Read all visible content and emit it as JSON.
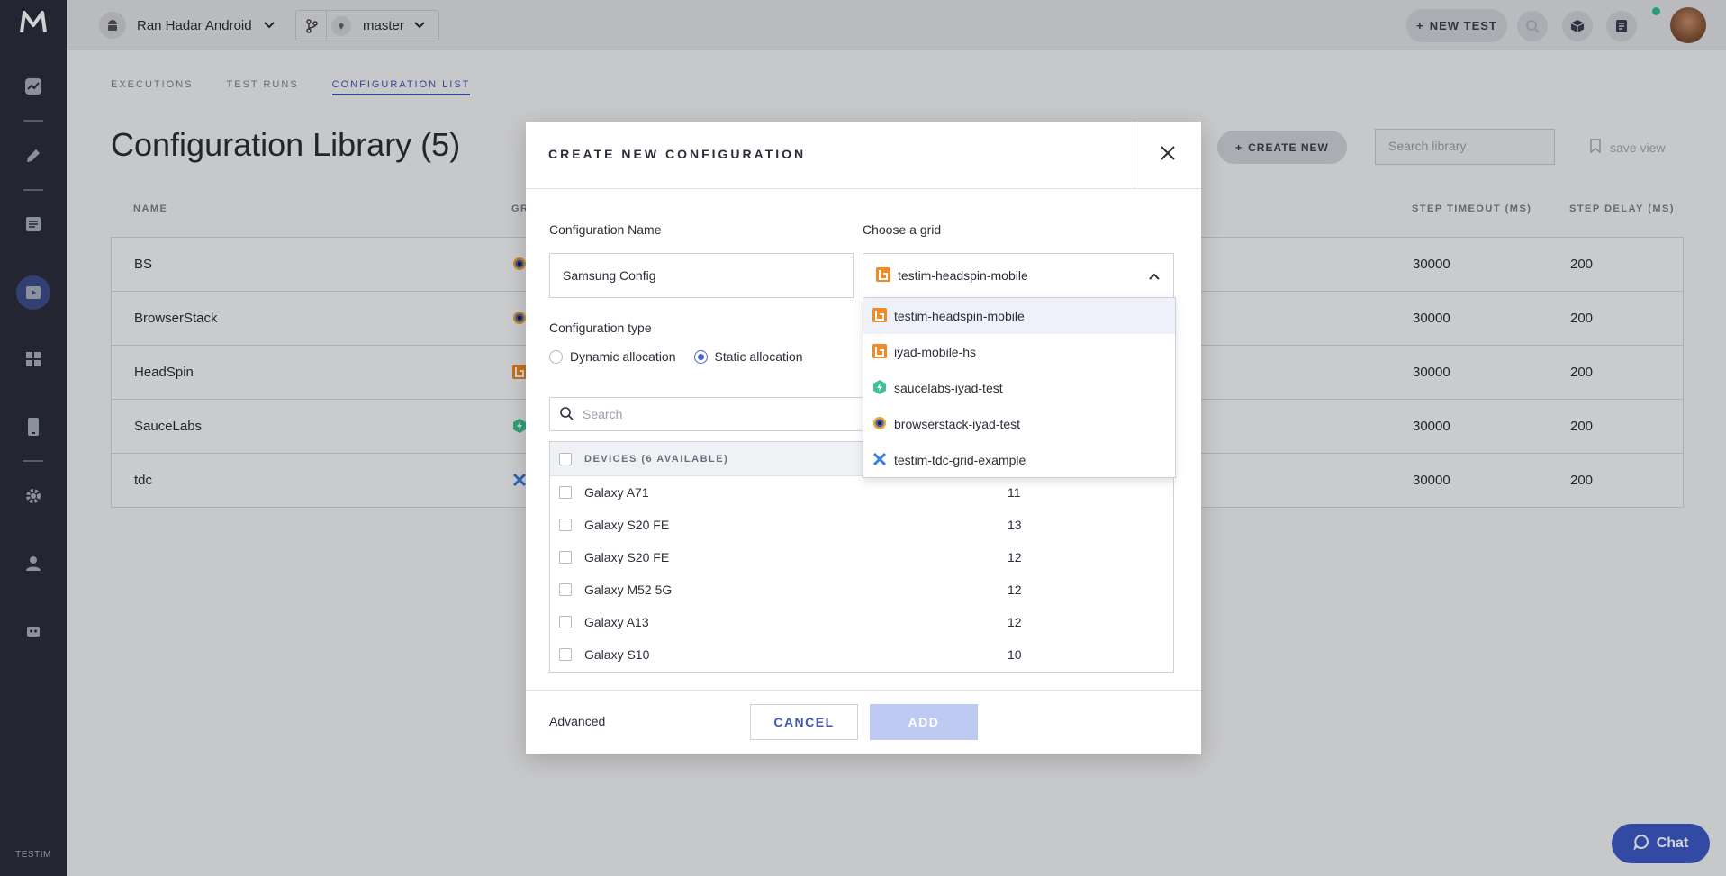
{
  "topbar": {
    "project_name": "Ran Hadar Android",
    "branch": "master",
    "new_test_label": "NEW TEST"
  },
  "sidebar": {
    "brand": "TESTIM"
  },
  "tabs": [
    "EXECUTIONS",
    "TEST RUNS",
    "CONFIGURATION LIST"
  ],
  "page": {
    "title": "Configuration Library (5)",
    "create_new_label": "CREATE NEW",
    "search_placeholder": "Search library",
    "save_view_label": "save view"
  },
  "table": {
    "columns": {
      "name": "NAME",
      "grid": "GR",
      "step_timeout": "STEP TIMEOUT (MS)",
      "step_delay": "STEP DELAY (MS)"
    },
    "rows": [
      {
        "name": "BS",
        "grid_icon": "browserstack-icon",
        "timeout": "30000",
        "delay": "200"
      },
      {
        "name": "BrowserStack",
        "grid_icon": "browserstack-icon",
        "timeout": "30000",
        "delay": "200"
      },
      {
        "name": "HeadSpin",
        "grid_icon": "headspin-icon",
        "timeout": "30000",
        "delay": "200"
      },
      {
        "name": "SauceLabs",
        "grid_icon": "saucelabs-icon",
        "timeout": "30000",
        "delay": "200"
      },
      {
        "name": "tdc",
        "grid_icon": "tdc-icon",
        "timeout": "30000",
        "delay": "200"
      }
    ]
  },
  "modal": {
    "title": "CREATE NEW CONFIGURATION",
    "config_name_label": "Configuration Name",
    "config_name_value": "Samsung Config",
    "grid_label": "Choose a grid",
    "grid_value": "testim-headspin-mobile",
    "config_type_label": "Configuration type",
    "radio_dynamic": "Dynamic allocation",
    "radio_static": "Static allocation",
    "selected_type": "static",
    "search_placeholder": "Search",
    "devices_header": "DEVICES (6 AVAILABLE)",
    "devices": [
      {
        "name": "Galaxy A71",
        "version": "11"
      },
      {
        "name": "Galaxy S20 FE",
        "version": "13"
      },
      {
        "name": "Galaxy S20 FE",
        "version": "12"
      },
      {
        "name": "Galaxy M52 5G",
        "version": "12"
      },
      {
        "name": "Galaxy A13",
        "version": "12"
      },
      {
        "name": "Galaxy S10",
        "version": "10"
      }
    ],
    "advanced_label": "Advanced",
    "cancel_label": "CANCEL",
    "add_label": "ADD"
  },
  "grid_options": [
    {
      "label": "testim-headspin-mobile",
      "icon": "headspin-icon",
      "selected": true
    },
    {
      "label": "iyad-mobile-hs",
      "icon": "headspin-icon",
      "selected": false
    },
    {
      "label": "saucelabs-iyad-test",
      "icon": "saucelabs-icon",
      "selected": false
    },
    {
      "label": "browserstack-iyad-test",
      "icon": "browserstack-icon",
      "selected": false
    },
    {
      "label": "testim-tdc-grid-example",
      "icon": "tdc-icon",
      "selected": false
    }
  ],
  "chat_label": "Chat",
  "colors": {
    "accent": "#4257b2",
    "sidebar": "#2b2f3d",
    "headspin": "#f08a24",
    "saucelabs": "#3ec28f",
    "tdc": "#3b7de0"
  }
}
